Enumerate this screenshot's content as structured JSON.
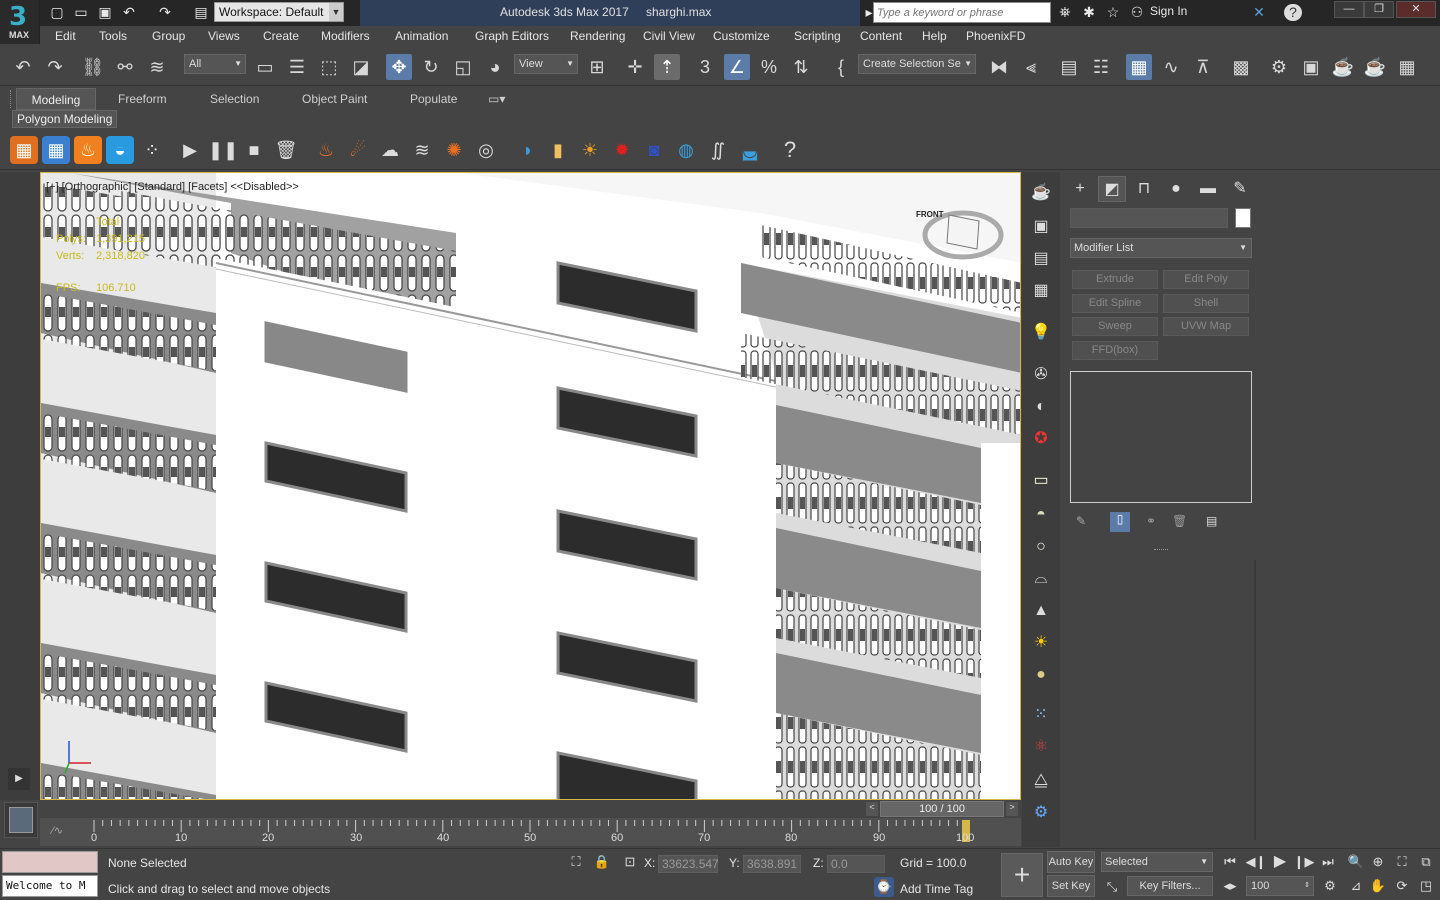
{
  "app": {
    "logo_number": "3",
    "logo_text": "MAX",
    "title": "Autodesk 3ds Max 2017",
    "file": "sharghi.max",
    "workspace": "Workspace: Default",
    "search_placeholder": "Type a keyword or phrase",
    "sign_in": "Sign In"
  },
  "menu": [
    "Edit",
    "Tools",
    "Group",
    "Views",
    "Create",
    "Modifiers",
    "Animation",
    "Graph Editors",
    "Rendering",
    "Civil View",
    "Customize",
    "Scripting",
    "Content",
    "Help",
    "PhoenixFD"
  ],
  "toolbar": {
    "selection_filter": "All",
    "ref_coord": "View",
    "named_selection": "Create Selection Se"
  },
  "ribbon": {
    "tabs": [
      "Modeling",
      "Freeform",
      "Selection",
      "Object Paint",
      "Populate"
    ],
    "active_tab": "Modeling",
    "panel": "Polygon Modeling"
  },
  "viewport": {
    "label": "[+] [Orthographic] [Standard] [Facets]  <<Disabled>>",
    "stats": {
      "total_label": "Total",
      "polys_label": "Polys:",
      "polys": "1,391,215",
      "verts_label": "Verts:",
      "verts": "2,318,820",
      "fps_label": "FPS:",
      "fps": "106.710"
    },
    "viewcube_label": "FRONT"
  },
  "command_panel": {
    "modifier_list": "Modifier List",
    "buttons": [
      "Extrude",
      "Edit Poly",
      "Edit Spline",
      "Shell",
      "Sweep",
      "UVW Map",
      "FFD(box)"
    ]
  },
  "timeline": {
    "frame_counter": "100 / 100",
    "ticks": [
      "0",
      "10",
      "20",
      "30",
      "40",
      "50",
      "60",
      "70",
      "80",
      "90",
      "100"
    ],
    "current_frame": 100
  },
  "status": {
    "maxscript": "Welcome to M",
    "selection": "None Selected",
    "prompt": "Click and drag to select and move objects",
    "x_label": "X:",
    "x": "33623.547",
    "y_label": "Y:",
    "y": "3638.891",
    "z_label": "Z:",
    "z": "0.0",
    "grid": "Grid = 100.0",
    "add_time_tag": "Add Time Tag",
    "auto_key": "Auto Key",
    "set_key": "Set Key",
    "key_mode": "Selected",
    "key_filters": "Key Filters...",
    "frame_field": "100"
  },
  "colors": {
    "accent": "#5b7ba8",
    "viewport_border": "#d6b84a",
    "stats": "#c9b91f"
  }
}
